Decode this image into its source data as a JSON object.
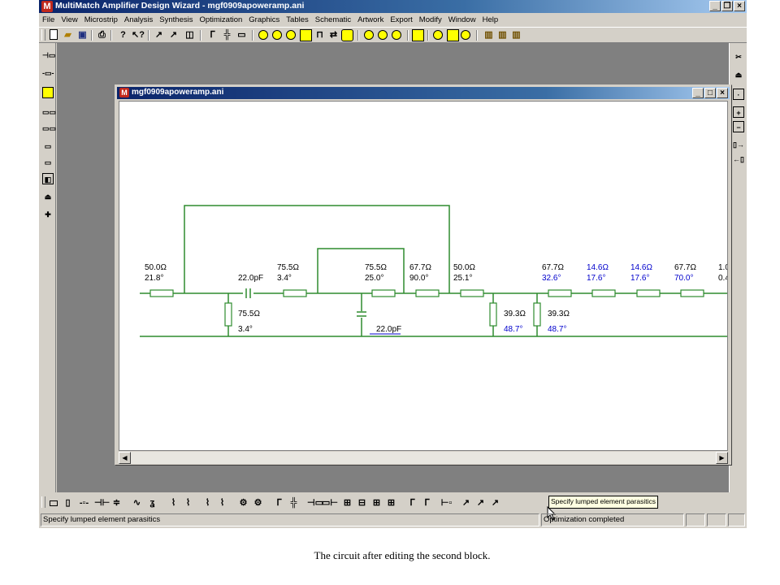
{
  "window": {
    "title": "MultiMatch Amplifier Design Wizard - mgf0909apoweramp.ani",
    "buttons": [
      "_",
      "×"
    ]
  },
  "menu": [
    "File",
    "View",
    "Microstrip",
    "Analysis",
    "Synthesis",
    "Optimization",
    "Graphics",
    "Tables",
    "Schematic",
    "Artwork",
    "Export",
    "Modify",
    "Window",
    "Help"
  ],
  "child_window": {
    "title": "mgf0909apoweramp.ani"
  },
  "circuit": {
    "labels": {
      "a1": "50.0Ω",
      "a2": "21.8°",
      "b1": "22.0pF",
      "c1": "75.5Ω",
      "c2": "3.4°",
      "d1": "75.5Ω",
      "d2": "25.0°",
      "e1": "67.7Ω",
      "e2": "90.0°",
      "f1": "50.0Ω",
      "f2": "25.1°",
      "g1": "67.7Ω",
      "g2": "32.6°",
      "h1": "14.6Ω",
      "h2": "17.6°",
      "i1": "14.6Ω",
      "i2": "17.6°",
      "j1": "67.7Ω",
      "j2": "70.0°",
      "k1": "1.0",
      "k2": "0.4",
      "s1a": "75.5Ω",
      "s1b": "3.4°",
      "s2": "22.0pF",
      "s3a": "39.3Ω",
      "s3b": "48.7°",
      "s4a": "39.3Ω",
      "s4b": "48.7°"
    },
    "colors": {
      "wire": "#2e8b2e",
      "black_text": "#000000",
      "blue_text": "#0000cc"
    }
  },
  "tooltip": "Specify lumped element parasitics",
  "status": {
    "left": "Specify lumped element parasitics",
    "right": "Optimization completed"
  },
  "caption": "The circuit after editing the second block."
}
